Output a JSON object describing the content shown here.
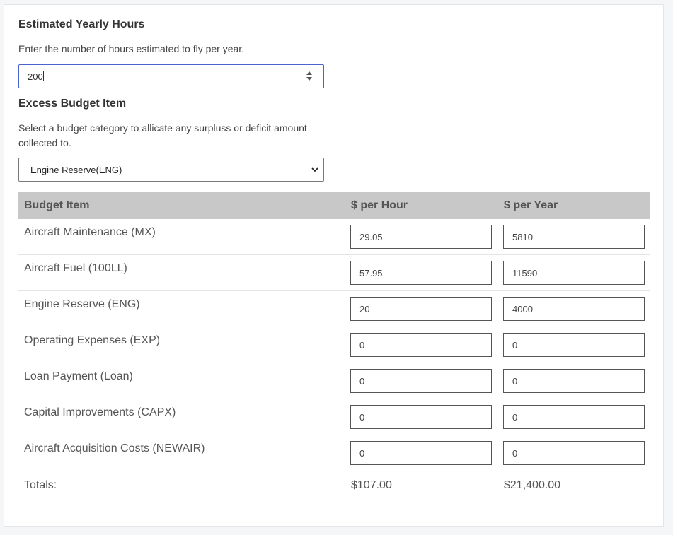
{
  "hours": {
    "title": "Estimated Yearly Hours",
    "help": "Enter the number of hours estimated to fly per year.",
    "value": "200"
  },
  "excess": {
    "title": "Excess Budget Item",
    "help_line1": "Select a budget category to allicate any surpluss or deficit amount",
    "help_line2": "collected to.",
    "selected": "Engine Reserve(ENG)"
  },
  "table": {
    "headers": [
      "Budget Item",
      "$ per Hour",
      "$ per Year"
    ],
    "rows": [
      {
        "label": "Aircraft Maintenance (MX)",
        "per_hour": "29.05",
        "per_year": "5810"
      },
      {
        "label": "Aircraft Fuel (100LL)",
        "per_hour": "57.95",
        "per_year": "11590"
      },
      {
        "label": "Engine Reserve (ENG)",
        "per_hour": "20",
        "per_year": "4000"
      },
      {
        "label": "Operating Expenses (EXP)",
        "per_hour": "0",
        "per_year": "0"
      },
      {
        "label": "Loan Payment (Loan)",
        "per_hour": "0",
        "per_year": "0"
      },
      {
        "label": "Capital Improvements (CAPX)",
        "per_hour": "0",
        "per_year": "0"
      },
      {
        "label": "Aircraft Acquisition Costs (NEWAIR)",
        "per_hour": "0",
        "per_year": "0"
      }
    ],
    "totals": {
      "label": "Totals:",
      "per_hour": "$107.00",
      "per_year": "$21,400.00"
    }
  },
  "colors": {
    "header_bg": "#c8c8c8",
    "focus_border": "#4a63d0"
  },
  "icons": {
    "spinner": "spinner-icon",
    "dropdown": "chevron-down-icon"
  }
}
